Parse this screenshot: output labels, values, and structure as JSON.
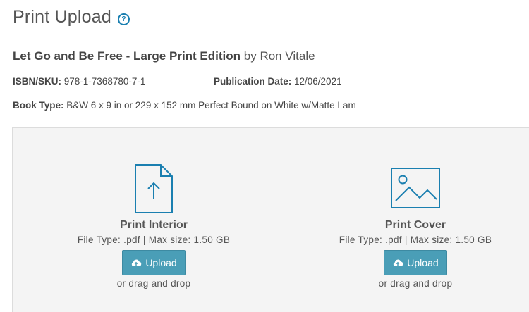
{
  "header": {
    "title": "Print Upload",
    "help_icon": "question-circle-icon"
  },
  "book": {
    "title": "Let Go and Be Free - Large Print Edition",
    "by": " by Ron Vitale",
    "isbn_label": "ISBN/SKU:",
    "isbn_value": " 978-1-7368780-7-1",
    "pub_label": "Publication Date:",
    "pub_value": " 12/06/2021",
    "type_label": "Book Type:",
    "type_value": " B&W 6 x 9 in or 229 x 152 mm Perfect Bound on White w/Matte Lam"
  },
  "panels": [
    {
      "icon": "file-upload-icon",
      "label": "Print Interior",
      "file_type": "File Type: .pdf | Max size: 1.50 GB",
      "button_label": "Upload",
      "drag_text": "or drag and drop"
    },
    {
      "icon": "image-icon",
      "label": "Print Cover",
      "file_type": "File Type: .pdf | Max size: 1.50 GB",
      "button_label": "Upload",
      "drag_text": "or drag and drop"
    }
  ],
  "colors": {
    "accent": "#1a7fb0",
    "button": "#4a9eb7",
    "panel_bg": "#f4f4f4"
  }
}
